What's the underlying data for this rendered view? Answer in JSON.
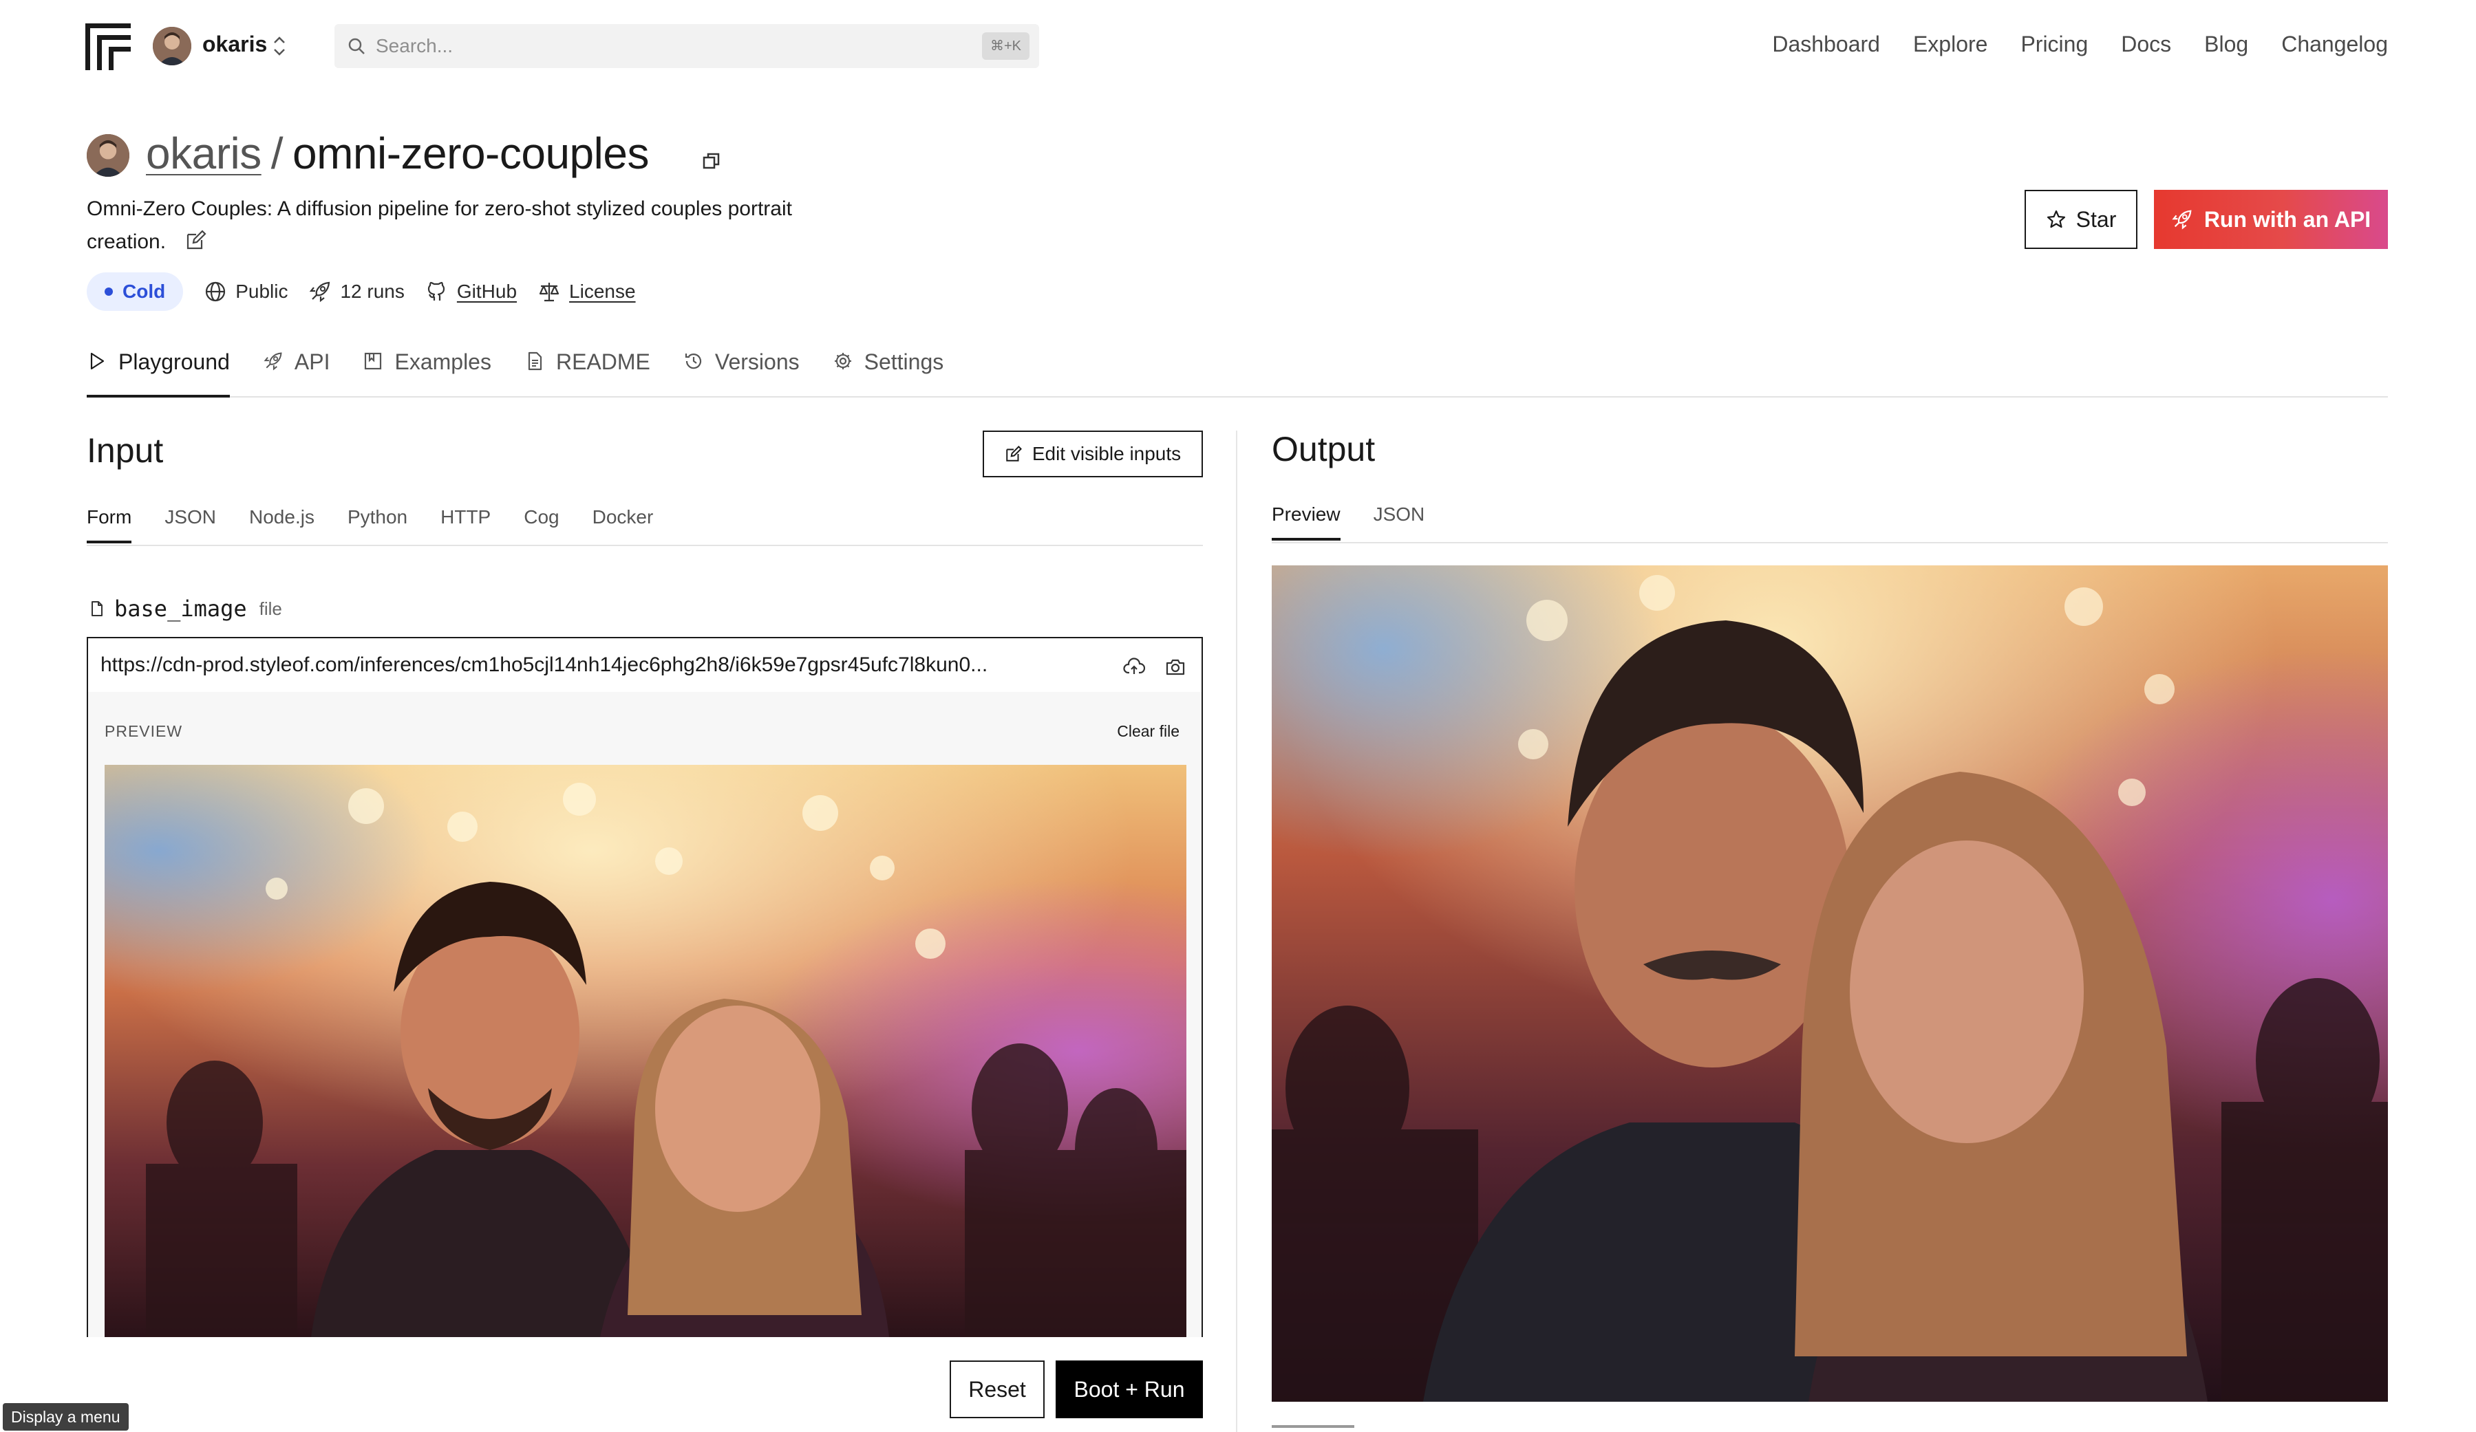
{
  "nav": {
    "username": "okaris",
    "search_placeholder": "Search...",
    "search_shortcut": "⌘+K",
    "links": [
      "Dashboard",
      "Explore",
      "Pricing",
      "Docs",
      "Blog",
      "Changelog"
    ]
  },
  "header": {
    "owner": "okaris",
    "separator": "/",
    "model": "omni-zero-couples",
    "description": "Omni-Zero Couples: A diffusion pipeline for zero-shot stylized couples portrait creation.",
    "status": "Cold",
    "visibility": "Public",
    "runs": "12 runs",
    "github": "GitHub",
    "license": "License",
    "star_label": "Star",
    "api_label": "Run with an API"
  },
  "page_tabs": [
    "Playground",
    "API",
    "Examples",
    "README",
    "Versions",
    "Settings"
  ],
  "input": {
    "title": "Input",
    "edit_visible_label": "Edit visible inputs",
    "tabs": [
      "Form",
      "JSON",
      "Node.js",
      "Python",
      "HTTP",
      "Cog",
      "Docker"
    ],
    "field_name": "base_image",
    "field_type": "file",
    "url_value": "https://cdn-prod.styleof.com/inferences/cm1ho5cjl14nh14jec6phg2h8/i6k59e7gpsr45ufc7l8kun0...",
    "preview_label": "PREVIEW",
    "clear_label": "Clear file",
    "reset_label": "Reset",
    "run_label": "Boot + Run"
  },
  "output": {
    "title": "Output",
    "tabs": [
      "Preview",
      "JSON"
    ]
  },
  "tooltip": "Display a menu",
  "colors": {
    "accent_red": "#e6392f",
    "accent_pink": "#d94a8c",
    "cold_bg": "#e9efff",
    "cold_text": "#2c4fd8"
  }
}
